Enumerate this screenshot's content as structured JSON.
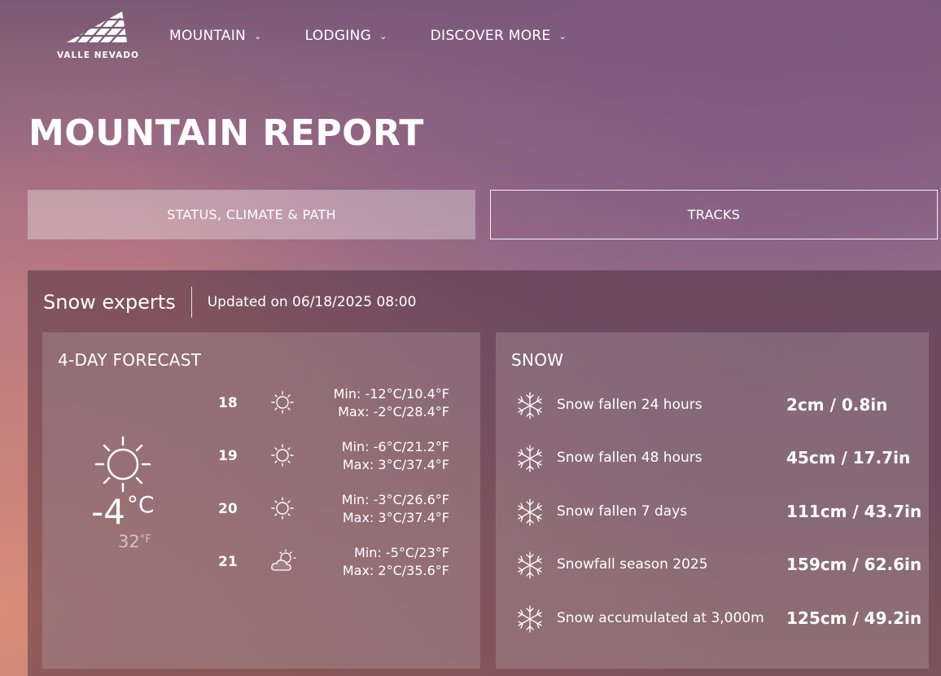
{
  "header": {
    "logo_text": "VALLE NEVADO",
    "nav": [
      {
        "label": "MOUNTAIN"
      },
      {
        "label": "LODGING"
      },
      {
        "label": "DISCOVER MORE"
      }
    ]
  },
  "page_title": "MOUNTAIN REPORT",
  "tabs": [
    {
      "label": "STATUS, CLIMATE & PATH",
      "active": true
    },
    {
      "label": "TRACKS",
      "active": false
    }
  ],
  "panel": {
    "source": "Snow experts",
    "updated": "Updated on 06/18/2025 08:00"
  },
  "forecast": {
    "title": "4-DAY FORECAST",
    "current": {
      "icon": "sun-icon",
      "temp": "-4",
      "unit_c": "°C",
      "temp_f": "32",
      "unit_f": "°F"
    },
    "days": [
      {
        "day": "18",
        "icon": "sun-icon",
        "min": "Min: -12°C/10.4°F",
        "max": "Max: -2°C/28.4°F"
      },
      {
        "day": "19",
        "icon": "sun-icon",
        "min": "Min: -6°C/21.2°F",
        "max": "Max: 3°C/37.4°F"
      },
      {
        "day": "20",
        "icon": "sun-icon",
        "min": "Min: -3°C/26.6°F",
        "max": "Max: 3°C/37.4°F"
      },
      {
        "day": "21",
        "icon": "partly-cloudy-icon",
        "min": "Min: -5°C/23°F",
        "max": "Max: 2°C/35.6°F"
      }
    ]
  },
  "snow": {
    "title": "SNOW",
    "rows": [
      {
        "icon": "snowflake-icon",
        "label": "Snow fallen 24 hours",
        "value": "2cm / 0.8in"
      },
      {
        "icon": "snowflake-icon",
        "label": "Snow fallen 48 hours",
        "value": "45cm / 17.7in"
      },
      {
        "icon": "snowflake-icon",
        "label": "Snow fallen 7 days",
        "value": "111cm / 43.7in"
      },
      {
        "icon": "snowflake-icon",
        "label": "Snowfall season 2025",
        "value": "159cm / 62.6in"
      },
      {
        "icon": "snowflake-icon",
        "label": "Snow accumulated at 3,000m",
        "value": "125cm / 49.2in"
      }
    ]
  }
}
